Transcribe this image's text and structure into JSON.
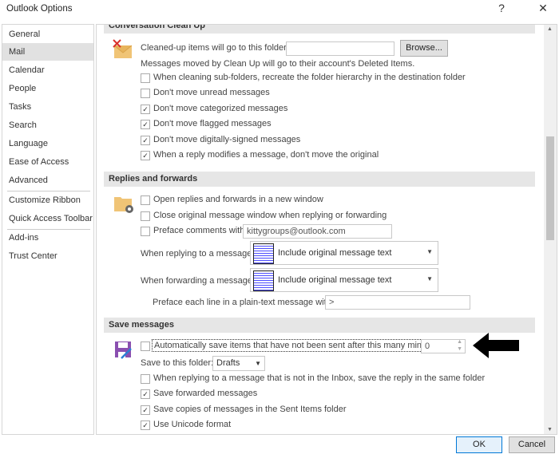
{
  "window": {
    "title": "Outlook Options",
    "help": "?",
    "close": "✕"
  },
  "sidebar": {
    "items": [
      {
        "label": "General"
      },
      {
        "label": "Mail"
      },
      {
        "label": "Calendar"
      },
      {
        "label": "People"
      },
      {
        "label": "Tasks"
      },
      {
        "label": "Search"
      },
      {
        "label": "Language"
      },
      {
        "label": "Ease of Access"
      },
      {
        "label": "Advanced"
      },
      {
        "label": "Customize Ribbon"
      },
      {
        "label": "Quick Access Toolbar"
      },
      {
        "label": "Add-ins"
      },
      {
        "label": "Trust Center"
      }
    ],
    "selected": "Mail"
  },
  "cleanup": {
    "header": "Conversation Clean Up",
    "folder_label": "Cleaned-up items will go to this folder:",
    "folder_value": "",
    "browse": "Browse...",
    "note": "Messages moved by Clean Up will go to their account's Deleted Items.",
    "options": [
      {
        "label": "When cleaning sub-folders, recreate the folder hierarchy in the destination folder",
        "checked": false
      },
      {
        "label": "Don't move unread messages",
        "checked": false
      },
      {
        "label": "Don't move categorized messages",
        "checked": true
      },
      {
        "label": "Don't move flagged messages",
        "checked": true
      },
      {
        "label": "Don't move digitally-signed messages",
        "checked": true
      },
      {
        "label": "When a reply modifies a message, don't move the original",
        "checked": true
      }
    ]
  },
  "replies": {
    "header": "Replies and forwards",
    "options": [
      {
        "label": "Open replies and forwards in a new window",
        "checked": false
      },
      {
        "label": "Close original message window when replying or forwarding",
        "checked": false
      },
      {
        "label": "Preface comments with:",
        "checked": false
      }
    ],
    "preface_value": "kittygroups@outlook.com",
    "reply_label": "When replying to a message:",
    "reply_value": "Include original message text",
    "forward_label": "When forwarding a message:",
    "forward_value": "Include original message text",
    "plain_label": "Preface each line in a plain-text message with:",
    "plain_value": ">"
  },
  "save": {
    "header": "Save messages",
    "autosave_label": "Automatically save items that have not been sent after this many minutes:",
    "autosave_checked": false,
    "minutes": "0",
    "folder_label": "Save to this folder:",
    "folder_value": "Drafts",
    "options": [
      {
        "label": "When replying to a message that is not in the Inbox, save the reply in the same folder",
        "checked": false
      },
      {
        "label": "Save forwarded messages",
        "checked": true
      },
      {
        "label": "Save copies of messages in the Sent Items folder",
        "checked": true
      },
      {
        "label": "Use Unicode format",
        "checked": true
      }
    ]
  },
  "footer": {
    "ok": "OK",
    "cancel": "Cancel"
  }
}
